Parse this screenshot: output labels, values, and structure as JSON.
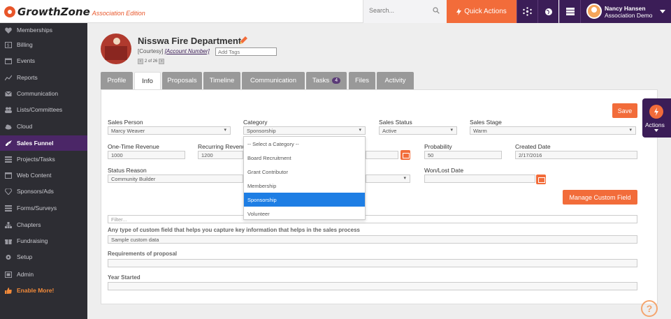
{
  "app": {
    "logo_text": "GrowthZone",
    "logo_sub": "Association Edition"
  },
  "topbar": {
    "search_placeholder": "Search...",
    "quick_actions": "Quick Actions",
    "user_name": "Nancy Hansen",
    "user_org": "Association Demo"
  },
  "sidebar": {
    "items": [
      {
        "label": "Memberships"
      },
      {
        "label": "Billing"
      },
      {
        "label": "Events"
      },
      {
        "label": "Reports"
      },
      {
        "label": "Communication"
      },
      {
        "label": "Lists/Committees"
      },
      {
        "label": "Cloud"
      },
      {
        "label": "Sales Funnel"
      },
      {
        "label": "Projects/Tasks"
      },
      {
        "label": "Web Content"
      },
      {
        "label": "Sponsors/Ads"
      },
      {
        "label": "Forms/Surveys"
      },
      {
        "label": "Chapters"
      },
      {
        "label": "Fundraising"
      },
      {
        "label": "Setup"
      },
      {
        "label": "Admin"
      },
      {
        "label": "Enable More!"
      }
    ],
    "active": "Sales Funnel"
  },
  "record": {
    "name": "Nisswa Fire Department",
    "courtesy": "[Courtesy]",
    "account_number": "[Account Number]",
    "add_tags_placeholder": "Add Tags",
    "pager": "2 of 26"
  },
  "tabs": [
    {
      "label": "Profile"
    },
    {
      "label": "Info"
    },
    {
      "label": "Proposals"
    },
    {
      "label": "Timeline"
    },
    {
      "label": "Communication"
    },
    {
      "label": "Tasks",
      "badge": "4"
    },
    {
      "label": "Files"
    },
    {
      "label": "Activity"
    }
  ],
  "active_tab": "Info",
  "form": {
    "save_label": "Save",
    "sales_person_label": "Sales Person",
    "sales_person_value": "Marcy Weaver",
    "category_label": "Category",
    "category_value": "Sponsorship",
    "sales_status_label": "Sales Status",
    "sales_status_value": "Active",
    "sales_stage_label": "Sales Stage",
    "sales_stage_value": "Warm",
    "one_time_revenue_label": "One-Time Revenue",
    "one_time_revenue_value": "1000",
    "recurring_revenue_label": "Recurring Revenue",
    "recurring_revenue_value": "1200",
    "probability_label": "Probability",
    "probability_value": "50",
    "created_date_label": "Created Date",
    "created_date_value": "2/17/2016",
    "status_reason_label": "Status Reason",
    "status_reason_value": "Community Builder",
    "won_lost_label": "Won/Lost Date",
    "won_lost_value": "",
    "manage_custom_field": "Manage Custom Field",
    "filter_placeholder": "Filter...",
    "custom_field_label": "Any type of custom field that helps you capture key information that helps in the sales process",
    "custom_field_value": "Sample custom data",
    "requirements_label": "Requirements of proposal",
    "requirements_value": "",
    "year_started_label": "Year Started",
    "year_started_value": ""
  },
  "category_dropdown": {
    "options": [
      {
        "label": "-- Select a Category --"
      },
      {
        "label": "Board Recruitment"
      },
      {
        "label": "Grant Contributor"
      },
      {
        "label": "Membership"
      },
      {
        "label": "Sponsorship"
      },
      {
        "label": "Volunteer"
      }
    ],
    "selected": "Sponsorship"
  },
  "actions_tab": {
    "label": "Actions"
  },
  "help": {
    "label": "?"
  },
  "colors": {
    "brand_purple": "#3b1d57",
    "accent_orange": "#f26c3a",
    "sidebar_bg": "#2d2d33",
    "selected_blue": "#1e7ee4"
  }
}
